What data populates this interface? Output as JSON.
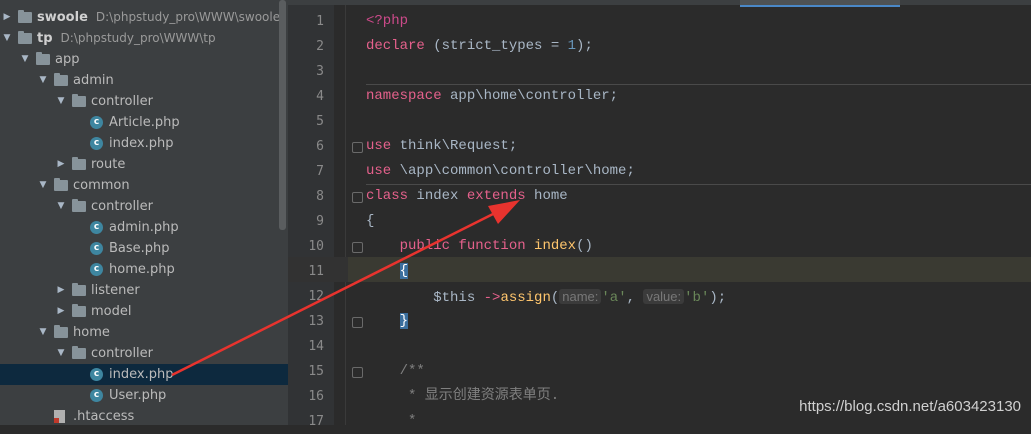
{
  "tree": {
    "items": [
      {
        "label": "swoole",
        "path": "D:\\phpstudy_pro\\WWW\\swoole",
        "kind": "folder",
        "depth": 0,
        "open": false,
        "bold": true
      },
      {
        "label": "tp",
        "path": "D:\\phpstudy_pro\\WWW\\tp",
        "kind": "folder",
        "depth": 0,
        "open": true,
        "bold": true
      },
      {
        "label": "app",
        "kind": "folder",
        "depth": 1,
        "open": true
      },
      {
        "label": "admin",
        "kind": "folder",
        "depth": 2,
        "open": true
      },
      {
        "label": "controller",
        "kind": "folder",
        "depth": 3,
        "open": true
      },
      {
        "label": "Article.php",
        "kind": "php",
        "depth": 4
      },
      {
        "label": "index.php",
        "kind": "php",
        "depth": 4
      },
      {
        "label": "route",
        "kind": "folder",
        "depth": 3,
        "open": false
      },
      {
        "label": "common",
        "kind": "folder",
        "depth": 2,
        "open": true
      },
      {
        "label": "controller",
        "kind": "folder",
        "depth": 3,
        "open": true
      },
      {
        "label": "admin.php",
        "kind": "php",
        "depth": 4
      },
      {
        "label": "Base.php",
        "kind": "php",
        "depth": 4
      },
      {
        "label": "home.php",
        "kind": "php",
        "depth": 4
      },
      {
        "label": "listener",
        "kind": "folder",
        "depth": 3,
        "open": false
      },
      {
        "label": "model",
        "kind": "folder",
        "depth": 3,
        "open": false
      },
      {
        "label": "home",
        "kind": "folder",
        "depth": 2,
        "open": true
      },
      {
        "label": "controller",
        "kind": "folder",
        "depth": 3,
        "open": true
      },
      {
        "label": "index.php",
        "kind": "php",
        "depth": 4,
        "selected": true
      },
      {
        "label": "User.php",
        "kind": "php",
        "depth": 4
      },
      {
        "label": ".htaccess",
        "kind": "other",
        "depth": 2
      }
    ]
  },
  "editor": {
    "lines": [
      {
        "n": "1",
        "tokens": [
          {
            "t": "<?php",
            "c": "tag"
          }
        ]
      },
      {
        "n": "2",
        "tokens": [
          {
            "t": "declare",
            "c": "pink"
          },
          {
            "t": " (strict_types = ",
            "c": ""
          },
          {
            "t": "1",
            "c": "num"
          },
          {
            "t": ");",
            "c": ""
          }
        ]
      },
      {
        "n": "3",
        "tokens": []
      },
      {
        "n": "4",
        "tokens": [
          {
            "t": "namespace",
            "c": "pink"
          },
          {
            "t": " app\\home\\controller;",
            "c": ""
          }
        ]
      },
      {
        "n": "5",
        "tokens": []
      },
      {
        "n": "6",
        "tokens": [
          {
            "t": "use",
            "c": "pink"
          },
          {
            "t": " think\\Request;",
            "c": ""
          }
        ]
      },
      {
        "n": "7",
        "tokens": [
          {
            "t": "use",
            "c": "pink"
          },
          {
            "t": " \\app\\common\\controller\\home;",
            "c": ""
          }
        ]
      },
      {
        "n": "8",
        "tokens": [
          {
            "t": "class",
            "c": "pink"
          },
          {
            "t": " index ",
            "c": ""
          },
          {
            "t": "extends",
            "c": "pink"
          },
          {
            "t": " home",
            "c": ""
          }
        ]
      },
      {
        "n": "9",
        "tokens": [
          {
            "t": "{",
            "c": ""
          }
        ]
      },
      {
        "n": "10",
        "tokens": [
          {
            "t": "    public ",
            "c": "pink"
          },
          {
            "t": "function",
            "c": "pink"
          },
          {
            "t": " ",
            "c": ""
          },
          {
            "t": "index",
            "c": "fn"
          },
          {
            "t": "()",
            "c": ""
          }
        ]
      },
      {
        "n": "11",
        "tokens": [
          {
            "t": "    ",
            "c": ""
          },
          {
            "t": "{",
            "c": "brace-hl"
          }
        ]
      },
      {
        "n": "12",
        "tokens": [
          {
            "t": "        $this ",
            "c": ""
          },
          {
            "t": "->",
            "c": "pink"
          },
          {
            "t": "assign",
            "c": "fn"
          },
          {
            "t": "(",
            "c": ""
          },
          {
            "t": "name:",
            "c": "hint"
          },
          {
            "t": "'a'",
            "c": "str"
          },
          {
            "t": ", ",
            "c": ""
          },
          {
            "t": "value:",
            "c": "hint"
          },
          {
            "t": "'b'",
            "c": "str"
          },
          {
            "t": ");",
            "c": ""
          }
        ]
      },
      {
        "n": "13",
        "tokens": [
          {
            "t": "    ",
            "c": ""
          },
          {
            "t": "}",
            "c": "brace-hl"
          }
        ]
      },
      {
        "n": "14",
        "tokens": []
      },
      {
        "n": "15",
        "tokens": [
          {
            "t": "    /**",
            "c": "cmt"
          }
        ]
      },
      {
        "n": "16",
        "tokens": [
          {
            "t": "     * 显示创建资源表单页.",
            "c": "cmt"
          }
        ]
      },
      {
        "n": "17",
        "tokens": [
          {
            "t": "     *",
            "c": "cmt"
          }
        ]
      }
    ]
  },
  "watermark": "https://blog.csdn.net/a603423130",
  "colors": {
    "annotation_arrow": "#e8332e",
    "selection": "#0d293e",
    "accent": "#4a88c7"
  }
}
